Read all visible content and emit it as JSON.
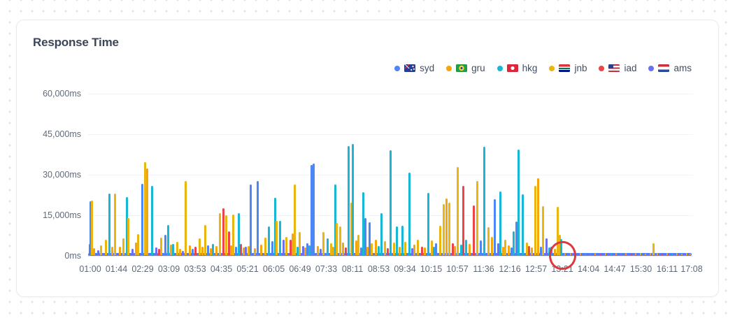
{
  "card": {
    "title": "Response Time"
  },
  "legend": [
    {
      "id": "syd",
      "label": "syd",
      "color": "#4d87f5",
      "flag": "flag-au",
      "flag_country": "australia"
    },
    {
      "id": "gru",
      "label": "gru",
      "color": "#f6a60d",
      "flag": "flag-br",
      "flag_country": "brazil"
    },
    {
      "id": "hkg",
      "label": "hkg",
      "color": "#19b7d6",
      "flag": "flag-hk",
      "flag_country": "hong-kong"
    },
    {
      "id": "jnb",
      "label": "jnb",
      "color": "#e9b50e",
      "flag": "flag-za",
      "flag_country": "south-africa"
    },
    {
      "id": "iad",
      "label": "iad",
      "color": "#ee4448",
      "flag": "flag-us",
      "flag_country": "united-states"
    },
    {
      "id": "ams",
      "label": "ams",
      "color": "#6a70ef",
      "flag": "flag-nl",
      "flag_country": "netherlands"
    }
  ],
  "chart_data": {
    "type": "bar",
    "title": "Response Time",
    "ylabel": "",
    "xlabel": "",
    "ylim": [
      0,
      60000
    ],
    "grid": "horizontal",
    "legend_position": "top-right",
    "y_ticks": [
      "60,000ms",
      "45,000ms",
      "30,000ms",
      "15,000ms",
      "0ms"
    ],
    "x_ticks": [
      "01:00",
      "01:44",
      "02:29",
      "03:09",
      "03:53",
      "04:35",
      "05:21",
      "06:05",
      "06:49",
      "07:33",
      "08:11",
      "08:53",
      "09:34",
      "10:15",
      "10:57",
      "11:36",
      "12:16",
      "12:57",
      "13:21",
      "14:04",
      "14:47",
      "15:30",
      "16:11",
      "17:08"
    ],
    "series_names": [
      "syd",
      "gru",
      "hkg",
      "jnb",
      "iad",
      "ams"
    ],
    "baseline_series": "ams",
    "baseline_value_ms": 300,
    "annotation": {
      "type": "circle",
      "x_tick": "13:21",
      "color": "#e0373f",
      "meaning": "highlighted anomaly at 13:21"
    },
    "spikes_format": [
      "x_px_of_865_plot",
      "series",
      "value_ms"
    ],
    "spikes": [
      [
        2,
        "iad",
        4200
      ],
      [
        3,
        "syd",
        19800
      ],
      [
        5,
        "jnb",
        20300
      ],
      [
        8,
        "gru",
        2600
      ],
      [
        14,
        "ams",
        1800
      ],
      [
        18,
        "jnb",
        3500
      ],
      [
        25,
        "jnb",
        5800
      ],
      [
        30,
        "hkg",
        22800
      ],
      [
        34,
        "gru",
        3000
      ],
      [
        38,
        "jnb",
        22800
      ],
      [
        45,
        "gru",
        3200
      ],
      [
        50,
        "jnb",
        6200
      ],
      [
        55,
        "hkg",
        21500
      ],
      [
        57,
        "jnb",
        13800
      ],
      [
        63,
        "ams",
        2400
      ],
      [
        68,
        "gru",
        4600
      ],
      [
        71,
        "jnb",
        7800
      ],
      [
        77,
        "syd",
        26300
      ],
      [
        81,
        "jnb",
        34500
      ],
      [
        84,
        "gru",
        32000
      ],
      [
        91,
        "hkg",
        25500
      ],
      [
        97,
        "ams",
        2800
      ],
      [
        101,
        "iad",
        2200
      ],
      [
        104,
        "jnb",
        6500
      ],
      [
        110,
        "syd",
        7500
      ],
      [
        114,
        "hkg",
        11000
      ],
      [
        118,
        "gru",
        3800
      ],
      [
        121,
        "hkg",
        4200
      ],
      [
        127,
        "jnb",
        4800
      ],
      [
        131,
        "gru",
        2400
      ],
      [
        135,
        "ams",
        1600
      ],
      [
        139,
        "jnb",
        27300
      ],
      [
        145,
        "gru",
        3600
      ],
      [
        149,
        "syd",
        2200
      ],
      [
        153,
        "iad",
        3000
      ],
      [
        159,
        "jnb",
        6100
      ],
      [
        163,
        "gru",
        3000
      ],
      [
        167,
        "jnb",
        11000
      ],
      [
        171,
        "syd",
        3600
      ],
      [
        175,
        "gru",
        2600
      ],
      [
        178,
        "hkg",
        4100
      ],
      [
        183,
        "gru",
        3400
      ],
      [
        188,
        "jnb",
        15400
      ],
      [
        193,
        "iad",
        17400
      ],
      [
        197,
        "jnb",
        14800
      ],
      [
        201,
        "iad",
        8800
      ],
      [
        204,
        "gru",
        3600
      ],
      [
        207,
        "jnb",
        14900
      ],
      [
        211,
        "syd",
        3000
      ],
      [
        215,
        "hkg",
        15500
      ],
      [
        218,
        "iad",
        4100
      ],
      [
        222,
        "gru",
        2800
      ],
      [
        225,
        "ams",
        3100
      ],
      [
        229,
        "jnb",
        3400
      ],
      [
        232,
        "syd",
        26000
      ],
      [
        238,
        "gru",
        2600
      ],
      [
        242,
        "syd",
        27500
      ],
      [
        247,
        "gru",
        3800
      ],
      [
        253,
        "jnb",
        6400
      ],
      [
        258,
        "hkg",
        10500
      ],
      [
        263,
        "syd",
        5200
      ],
      [
        267,
        "hkg",
        21300
      ],
      [
        269,
        "jnb",
        12600
      ],
      [
        274,
        "hkg",
        12800
      ],
      [
        279,
        "ams",
        5800
      ],
      [
        283,
        "jnb",
        6600
      ],
      [
        289,
        "iad",
        5600
      ],
      [
        292,
        "gru",
        8000
      ],
      [
        295,
        "jnb",
        26100
      ],
      [
        299,
        "hkg",
        3200
      ],
      [
        302,
        "jnb",
        8600
      ],
      [
        307,
        "ams",
        3400
      ],
      [
        310,
        "gru",
        2800
      ],
      [
        313,
        "syd",
        4300
      ],
      [
        316,
        "hkg",
        3600
      ],
      [
        319,
        "syd",
        33400
      ],
      [
        322,
        "syd",
        34000
      ],
      [
        328,
        "gru",
        3400
      ],
      [
        332,
        "ams",
        2200
      ],
      [
        336,
        "jnb",
        8600
      ],
      [
        342,
        "hkg",
        6200
      ],
      [
        347,
        "jnb",
        4400
      ],
      [
        350,
        "gru",
        3000
      ],
      [
        353,
        "hkg",
        26000
      ],
      [
        355,
        "jnb",
        11900
      ],
      [
        360,
        "jnb",
        10700
      ],
      [
        364,
        "gru",
        4600
      ],
      [
        368,
        "iad",
        2800
      ],
      [
        372,
        "hkg",
        40300
      ],
      [
        376,
        "jnb",
        19500
      ],
      [
        378,
        "hkg",
        41000
      ],
      [
        383,
        "gru",
        5400
      ],
      [
        386,
        "jnb",
        7600
      ],
      [
        390,
        "syd",
        2800
      ],
      [
        393,
        "hkg",
        23400
      ],
      [
        396,
        "syd",
        13800
      ],
      [
        399,
        "gru",
        3200
      ],
      [
        402,
        "syd",
        12200
      ],
      [
        405,
        "jnb",
        4400
      ],
      [
        411,
        "gru",
        5800
      ],
      [
        415,
        "hkg",
        3400
      ],
      [
        419,
        "hkg",
        15600
      ],
      [
        424,
        "jnb",
        5200
      ],
      [
        428,
        "iad",
        2600
      ],
      [
        432,
        "hkg",
        38700
      ],
      [
        437,
        "jnb",
        4600
      ],
      [
        441,
        "hkg",
        10600
      ],
      [
        445,
        "gru",
        3200
      ],
      [
        449,
        "hkg",
        10900
      ],
      [
        453,
        "jnb",
        5000
      ],
      [
        459,
        "hkg",
        30600
      ],
      [
        463,
        "ams",
        2600
      ],
      [
        466,
        "gru",
        4000
      ],
      [
        471,
        "jnb",
        5600
      ],
      [
        477,
        "iad",
        3200
      ],
      [
        481,
        "gru",
        2800
      ],
      [
        486,
        "hkg",
        22900
      ],
      [
        491,
        "jnb",
        5400
      ],
      [
        494,
        "hkg",
        3000
      ],
      [
        497,
        "syd",
        4400
      ],
      [
        503,
        "jnb",
        10800
      ],
      [
        508,
        "jnb",
        18800
      ],
      [
        512,
        "gru",
        21000
      ],
      [
        516,
        "jnb",
        19400
      ],
      [
        521,
        "iad",
        4400
      ],
      [
        524,
        "gru",
        3400
      ],
      [
        528,
        "jnb",
        32500
      ],
      [
        533,
        "hkg",
        3800
      ],
      [
        536,
        "iad",
        25700
      ],
      [
        540,
        "hkg",
        5600
      ],
      [
        545,
        "gru",
        4200
      ],
      [
        551,
        "iad",
        18400
      ],
      [
        556,
        "jnb",
        27500
      ],
      [
        561,
        "syd",
        5400
      ],
      [
        566,
        "hkg",
        40000
      ],
      [
        572,
        "jnb",
        10400
      ],
      [
        577,
        "gru",
        6800
      ],
      [
        581,
        "syd",
        20800
      ],
      [
        586,
        "ams",
        4400
      ],
      [
        589,
        "hkg",
        23500
      ],
      [
        593,
        "gru",
        3000
      ],
      [
        596,
        "jnb",
        5600
      ],
      [
        601,
        "gru",
        3600
      ],
      [
        605,
        "syd",
        2800
      ],
      [
        608,
        "hkg",
        8700
      ],
      [
        612,
        "syd",
        12400
      ],
      [
        615,
        "hkg",
        39000
      ],
      [
        621,
        "hkg",
        22500
      ],
      [
        627,
        "jnb",
        4600
      ],
      [
        630,
        "iad",
        3400
      ],
      [
        634,
        "gru",
        2800
      ],
      [
        639,
        "jnb",
        25500
      ],
      [
        643,
        "gru",
        28500
      ],
      [
        647,
        "syd",
        3000
      ],
      [
        650,
        "jnb",
        18000
      ],
      [
        655,
        "ams",
        6100
      ],
      [
        659,
        "hkg",
        2800
      ],
      [
        662,
        "syd",
        3200
      ],
      [
        667,
        "gru",
        2400
      ],
      [
        671,
        "jnb",
        17900
      ],
      [
        674,
        "jnb",
        7400
      ],
      [
        676,
        "hkg",
        5900
      ],
      [
        682,
        "gru",
        900
      ],
      [
        690,
        "gru",
        700
      ],
      [
        697,
        "iad",
        600
      ],
      [
        704,
        "gru",
        800
      ],
      [
        711,
        "hkg",
        600
      ],
      [
        718,
        "syd",
        700
      ],
      [
        725,
        "gru",
        800
      ],
      [
        733,
        "iad",
        500
      ],
      [
        740,
        "gru",
        700
      ],
      [
        748,
        "hkg",
        600
      ],
      [
        755,
        "gru",
        800
      ],
      [
        762,
        "syd",
        600
      ],
      [
        769,
        "gru",
        700
      ],
      [
        776,
        "iad",
        600
      ],
      [
        783,
        "gru",
        800
      ],
      [
        790,
        "jnb",
        700
      ],
      [
        797,
        "gru",
        600
      ],
      [
        804,
        "gru",
        900
      ],
      [
        808,
        "jnb",
        4500
      ],
      [
        814,
        "gru",
        700
      ],
      [
        821,
        "iad",
        500
      ],
      [
        828,
        "gru",
        800
      ],
      [
        835,
        "hkg",
        600
      ],
      [
        842,
        "gru",
        700
      ],
      [
        849,
        "jnb",
        600
      ],
      [
        856,
        "gru",
        800
      ],
      [
        861,
        "gru",
        600
      ]
    ]
  }
}
